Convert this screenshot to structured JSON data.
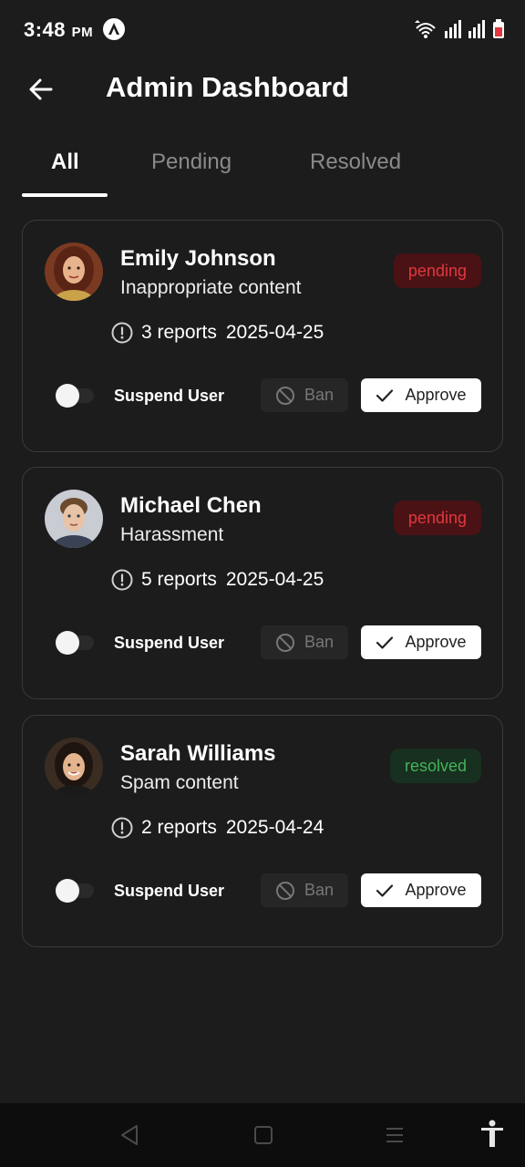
{
  "status_bar": {
    "time": "3:48",
    "ampm": "PM",
    "icons": [
      "app-notification-icon",
      "wifi-icon",
      "signal-icon",
      "signal-icon",
      "battery-icon"
    ]
  },
  "header": {
    "title": "Admin Dashboard",
    "back_icon": "arrow-left-icon"
  },
  "tabs": [
    {
      "label": "All",
      "active": true
    },
    {
      "label": "Pending",
      "active": false
    },
    {
      "label": "Resolved",
      "active": false
    }
  ],
  "reports": [
    {
      "name": "Emily Johnson",
      "reason": "Inappropriate content",
      "status": "pending",
      "reports_text": "3 reports",
      "date": "2025-04-25",
      "suspend_label": "Suspend User",
      "suspended": false,
      "ban_label": "Ban",
      "approve_label": "Approve"
    },
    {
      "name": "Michael Chen",
      "reason": "Harassment",
      "status": "pending",
      "reports_text": "5 reports",
      "date": "2025-04-25",
      "suspend_label": "Suspend User",
      "suspended": false,
      "ban_label": "Ban",
      "approve_label": "Approve"
    },
    {
      "name": "Sarah Williams",
      "reason": "Spam content",
      "status": "resolved",
      "reports_text": "2 reports",
      "date": "2025-04-24",
      "suspend_label": "Suspend User",
      "suspended": false,
      "ban_label": "Ban",
      "approve_label": "Approve"
    }
  ],
  "colors": {
    "background": "#1c1c1c",
    "card_border": "#3a3a3a",
    "pending_bg": "#4a1215",
    "pending_text": "#e0383e",
    "resolved_bg": "#17301f",
    "resolved_text": "#44b25a"
  },
  "nav_bar": {
    "icons": [
      "back-triangle-icon",
      "home-square-icon",
      "menu-lines-icon",
      "accessibility-icon"
    ]
  }
}
